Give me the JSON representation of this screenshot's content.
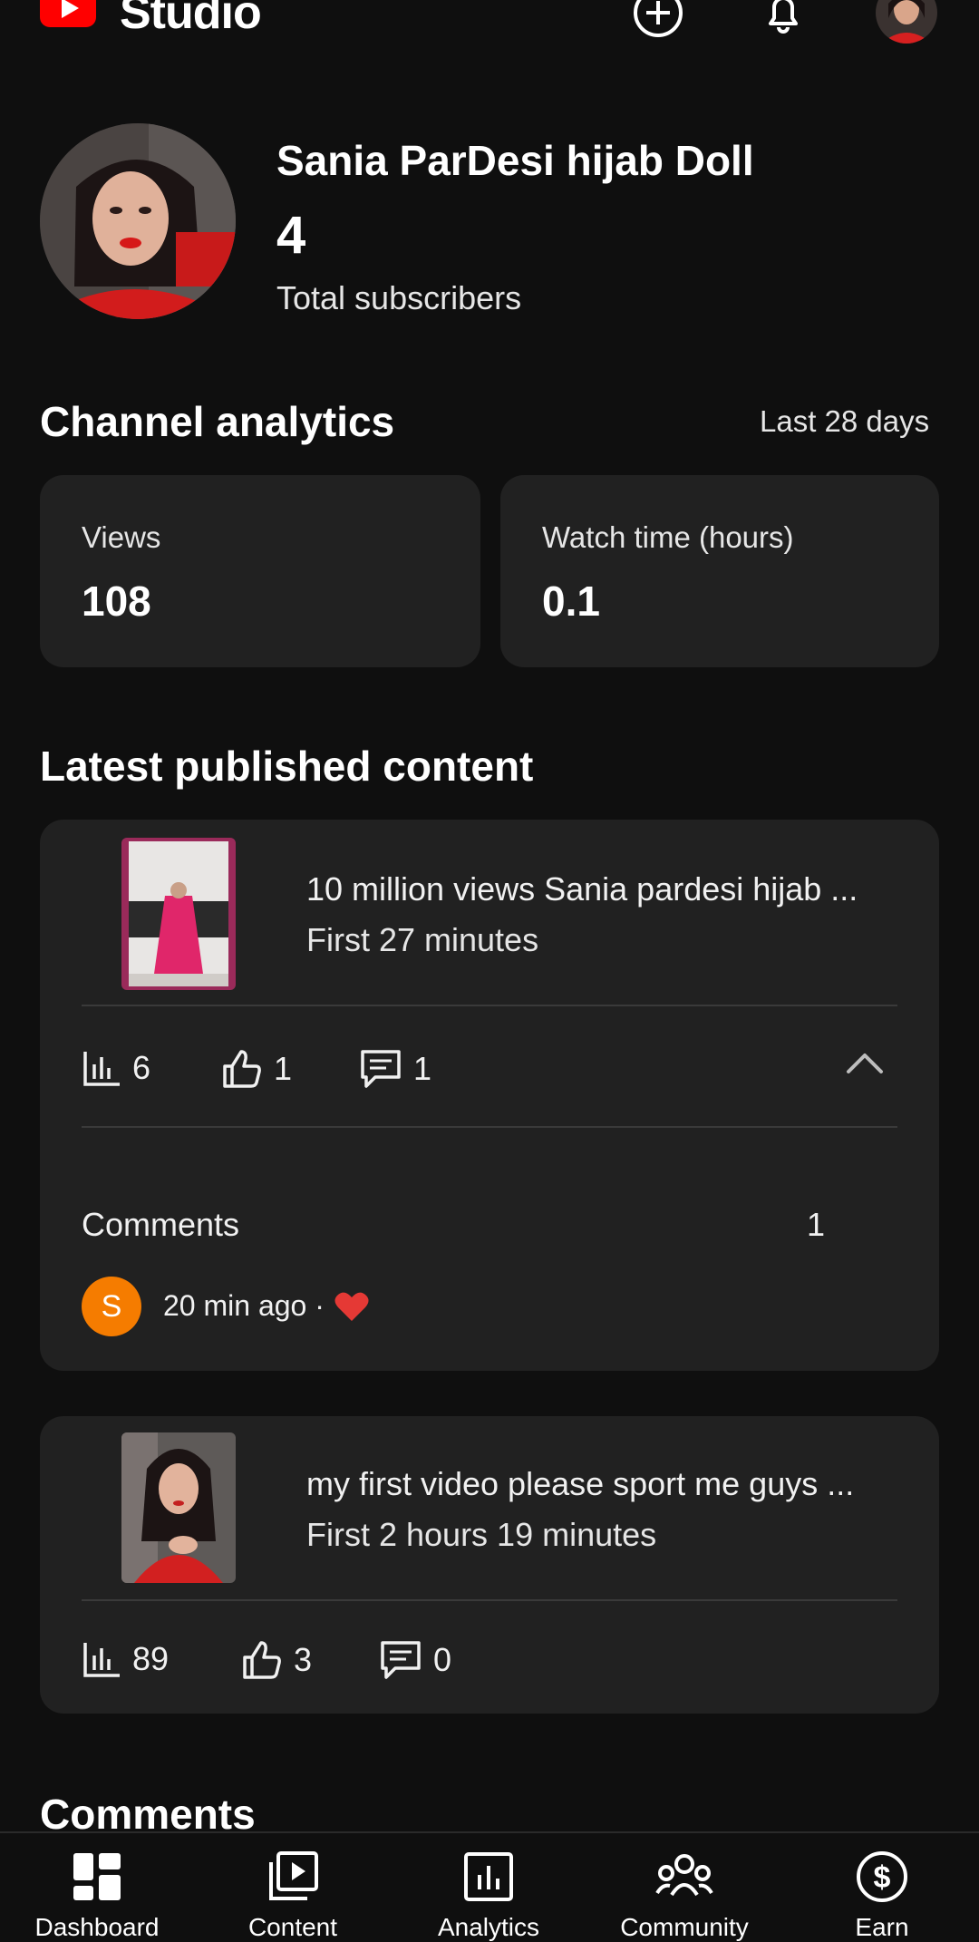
{
  "header": {
    "brand": "Studio",
    "icons": [
      "create-icon",
      "notifications-icon",
      "account-avatar"
    ]
  },
  "channel": {
    "name": "Sania ParDesi hijab Doll",
    "subscriber_count": "4",
    "subscriber_label": "Total subscribers"
  },
  "analytics": {
    "title": "Channel analytics",
    "range": "Last 28 days",
    "cards": [
      {
        "label": "Views",
        "value": "108"
      },
      {
        "label": "Watch time (hours)",
        "value": "0.1"
      }
    ]
  },
  "latest": {
    "title": "Latest published content",
    "videos": [
      {
        "title": "10 million views Sania pardesi hijab ...",
        "subtitle": "First 27 minutes",
        "views": "6",
        "likes": "1",
        "comments": "1",
        "expanded": true,
        "comments_label": "Comments",
        "comments_count": "1",
        "comment_initial": "S",
        "comment_time": "20 min ago ·"
      },
      {
        "title": "my first video please sport me guys ...",
        "subtitle": "First 2 hours 19 minutes",
        "views": "89",
        "likes": "3",
        "comments": "0"
      }
    ]
  },
  "comments_section": {
    "title": "Comments"
  },
  "nav": {
    "items": [
      {
        "label": "Dashboard",
        "icon": "dashboard-icon"
      },
      {
        "label": "Content",
        "icon": "content-icon"
      },
      {
        "label": "Analytics",
        "icon": "analytics-icon"
      },
      {
        "label": "Community",
        "icon": "community-icon"
      },
      {
        "label": "Earn",
        "icon": "earn-icon"
      }
    ]
  },
  "colors": {
    "background": "#0f0f0f",
    "card": "#212121",
    "brand_red": "#ff0000",
    "avatar_orange": "#f57c00",
    "heart": "#e53935"
  }
}
